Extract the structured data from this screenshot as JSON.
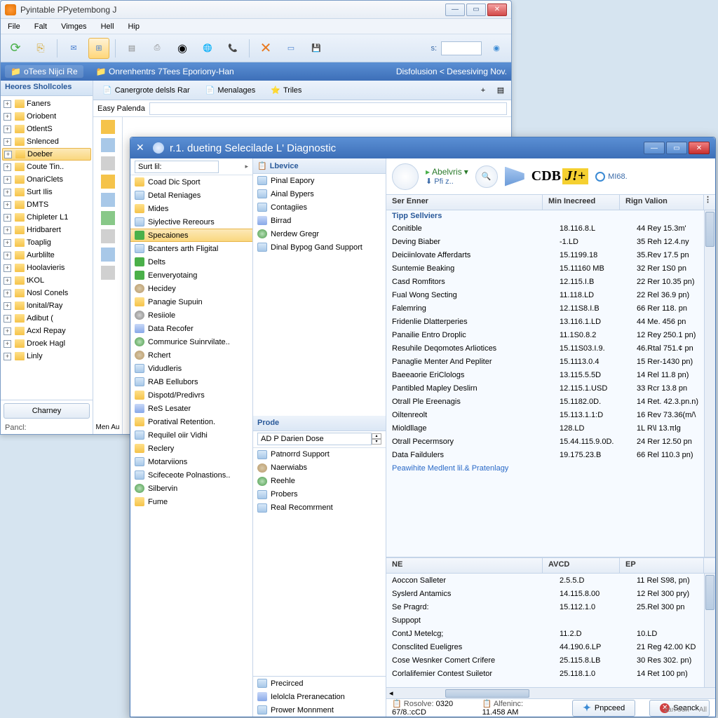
{
  "main": {
    "title": "Pyintable PPyetembong J",
    "menu": [
      "File",
      "Falt",
      "Vimges",
      "Hell",
      "Hip"
    ],
    "context_left": "Onrenhentrs 7Tees Eporiony-Han",
    "context_right": "Disfolusion < Desesiving Nov.",
    "sidebar_title": "Heores Shollcoles",
    "top_pill": "oTees Nijci Re",
    "sidebar_items": [
      {
        "label": "Faners"
      },
      {
        "label": "Oriobent"
      },
      {
        "label": "OtlentS"
      },
      {
        "label": "Snlenced"
      },
      {
        "label": "Doeber",
        "selected": true
      },
      {
        "label": "Coute Tin.."
      },
      {
        "label": "OnariClets"
      },
      {
        "label": "Surt Ilis"
      },
      {
        "label": "DMTS"
      },
      {
        "label": "Chipleter L1"
      },
      {
        "label": "Hridbarert"
      },
      {
        "label": "Toaplig"
      },
      {
        "label": "Aurblilte"
      },
      {
        "label": "Hoolavieris"
      },
      {
        "label": "tKOL"
      },
      {
        "label": "Nosl Conels"
      },
      {
        "label": "lonital/Ray"
      },
      {
        "label": "Adibut ("
      },
      {
        "label": "Acxl Repay"
      },
      {
        "label": "Droek Hagl"
      },
      {
        "label": "Linly"
      }
    ],
    "sidebar_button": "Charney",
    "sidebar_status": "Pancl:",
    "tabs": [
      "Canergrote delsls Rar",
      "Menalages",
      "Triles"
    ],
    "address_label": "Easy Palenda",
    "mini_label": "Men Au"
  },
  "diag": {
    "title": "r.1. dueting Selecilade L' Diagnostic",
    "left_input": "Surt lil:",
    "left_items": [
      {
        "label": "Coad Dic Sport",
        "ico": "ico-folder"
      },
      {
        "label": "Detal Reniages",
        "ico": "ico-doc"
      },
      {
        "label": "Mides",
        "ico": "ico-folder"
      },
      {
        "label": "Siylective Rereours",
        "ico": "ico-doc"
      },
      {
        "label": "Specaiones",
        "ico": "ico-check",
        "selected": true
      },
      {
        "label": "Bcanters arth Fligital",
        "ico": "ico-doc"
      },
      {
        "label": "Delts",
        "ico": "ico-check"
      },
      {
        "label": "Eenveryotaing",
        "ico": "ico-check"
      },
      {
        "label": "Hecidey",
        "ico": "ico-user"
      },
      {
        "label": "Panagie Supuin",
        "ico": "ico-folder"
      },
      {
        "label": "Resiiole",
        "ico": "ico-gear"
      },
      {
        "label": "Data Recofer",
        "ico": "ico-data"
      },
      {
        "label": "Commurice Suinrvilate..",
        "ico": "ico-globe"
      },
      {
        "label": "Rchert",
        "ico": "ico-user"
      },
      {
        "label": "Vidudleris",
        "ico": "ico-doc"
      },
      {
        "label": "RAB Eellubors",
        "ico": "ico-doc"
      },
      {
        "label": "Dispotd/Predivrs",
        "ico": "ico-folder"
      },
      {
        "label": "ReS Lesater",
        "ico": "ico-data"
      },
      {
        "label": "Poratival Retention.",
        "ico": "ico-folder"
      },
      {
        "label": "Requilel oiir Vidhi",
        "ico": "ico-doc"
      },
      {
        "label": "Reclery",
        "ico": "ico-folder"
      },
      {
        "label": "Motarviions",
        "ico": "ico-doc"
      },
      {
        "label": "Scifeceote Polnastions..",
        "ico": "ico-doc"
      },
      {
        "label": "Silbervin",
        "ico": "ico-globe"
      },
      {
        "label": "Fume",
        "ico": "ico-folder"
      }
    ],
    "mid_head1": "Lbevice",
    "mid_items1": [
      {
        "label": "Pinal Eapory",
        "ico": "ico-doc"
      },
      {
        "label": "Ainal Bypers",
        "ico": "ico-doc"
      },
      {
        "label": "Contagiies",
        "ico": "ico-doc"
      },
      {
        "label": "Birrad",
        "ico": "ico-data"
      },
      {
        "label": "Nerdew Gregr",
        "ico": "ico-globe"
      },
      {
        "label": "Dinal Bypog Gand Support",
        "ico": "ico-doc"
      }
    ],
    "mid_head2": "Prode",
    "mid_input2": "AD P Darien Dose",
    "mid_items2": [
      {
        "label": "Patnorrd Support",
        "ico": "ico-doc"
      },
      {
        "label": "Naerwiabs",
        "ico": "ico-user"
      },
      {
        "label": "Reehle",
        "ico": "ico-globe"
      },
      {
        "label": "Probers",
        "ico": "ico-doc"
      },
      {
        "label": "Real Recomrment",
        "ico": "ico-doc"
      }
    ],
    "mid_items3": [
      {
        "label": "Precirced",
        "ico": "ico-doc"
      },
      {
        "label": "Ielolcla Preranecation",
        "ico": "ico-data"
      },
      {
        "label": "Prower Monnment",
        "ico": "ico-doc"
      }
    ],
    "right_link": "Abelvris",
    "right_sub": "Pfi z..",
    "right_logo1": "CDB",
    "right_logo2": "J!+",
    "right_badge": "MI68.",
    "grid1_headers": [
      "Ser Enner",
      "Min Inecreed",
      "Rign Valion"
    ],
    "grid1_subhead": "Tipp Sellviers",
    "grid1_rows": [
      [
        "Conitible",
        "18.116.8.L",
        "44 Rey 15.3m'"
      ],
      [
        "Deving Biaber",
        "-1.LD",
        "35 Reh 12.4.ny"
      ],
      [
        "Deiciinlovate Afferdarts",
        "15.1199.18",
        "35.Rev 17.5 pn"
      ],
      [
        "Suntemie Beaking",
        "15.11160 MB",
        "32 Rer 1S0 pn"
      ],
      [
        "Casd Romfitors",
        "12.115.I.B",
        "22 Rer 10.35 pn)"
      ],
      [
        "Fual Wong Secting",
        "11.118.LD",
        "22 Rel 36.9 pn)"
      ],
      [
        "Falemring",
        "12.11S8.I.B",
        "66 Rer 118. pn"
      ],
      [
        "Fridenlie Dlatterperies",
        "13.116.1.LD",
        "44 Me. 456 pn"
      ],
      [
        "Panailie Entro Droplic",
        "11.1S0.8.2",
        "12 Rey 250.1 pn)"
      ],
      [
        "Resuhile Deqomotes Arliotices",
        "15.11S03.I.9.",
        "46.Rtal 751.¢ pn"
      ],
      [
        "Panaglie Menter And Pepliter",
        "15.1113.0.4",
        "15 Rer-1430 pn)"
      ],
      [
        "Baeeaorie EriClologs",
        "13.115.5.5D",
        "14 Rel 11.8 pn)"
      ],
      [
        "Pantibled Mapley Deslirn",
        "12.115.1.USD",
        "33 Rcr 13.8 pn"
      ],
      [
        "Otrall Ple Ereenagis",
        "15.1182.0D.",
        "14 Ret. 42.3.pn.n)"
      ],
      [
        "Oiltenreolt",
        "15.113.1.1:D",
        "16 Rev 73.36(m/\\"
      ],
      [
        "Mioldllage",
        "128.LD",
        "1L  R\\l 13.πlg"
      ],
      [
        "Otrall Pecermsory",
        "15.44.115.9.0D.",
        "24 Rer 12.50 pn"
      ],
      [
        "Data Faildulers",
        "19.175.23.B",
        "66 Rel 110.3 pn)"
      ]
    ],
    "grid1_link": "Peawihite Medlent lil.& Pratenlagy",
    "grid2_headers": [
      "NE",
      "AVCD",
      "EP"
    ],
    "grid2_rows": [
      [
        "Aoccon Salleter",
        "2.5.5.D",
        "11 Rel S98, pn)"
      ],
      [
        "Syslerd Antamics",
        "14.115.8.00",
        "12 Rel 300 pry)"
      ],
      [
        "Se Pragrd:",
        "15.112.1.0",
        "25.Rel 300 pn"
      ],
      [
        "Suppopt",
        "",
        ""
      ],
      [
        "ContJ Metelcg;",
        "11.2.D",
        "10.LD"
      ],
      [
        "Consclited Eueligres",
        "44.190.6.LP",
        "21 Reg 42.00 KD"
      ],
      [
        "Cose Wesnker Comert Crifere",
        "25.115.8.LB",
        "30 Res 302. pn)"
      ],
      [
        "Corlalifemier Contest Suiletor",
        "25.118.1.0",
        "14 Ret 100 pn)"
      ]
    ],
    "status": [
      {
        "label": "Rosolve:",
        "value": "0320 67/8.:cCD"
      },
      {
        "label": "Alfeninc:",
        "value": "11.458 AM"
      }
    ],
    "buttons": [
      "Pnpceed",
      "Seanck"
    ],
    "footer": [
      "zan oon",
      "All"
    ]
  }
}
